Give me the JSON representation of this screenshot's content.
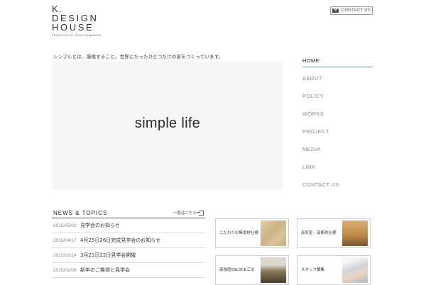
{
  "header": {
    "logo_line1": "K.",
    "logo_line2": "DESIGN",
    "logo_line3": "HOUSE",
    "logo_sub": "PRODUCED BY KENJI KAWAMATA",
    "contact_label": "CONTACT US"
  },
  "tagline": "シンプルとは、凝縮すること。世界にたったひとつだけの家をつくっています。",
  "hero": {
    "text": "simple life"
  },
  "nav": {
    "items": [
      {
        "label": "HOME"
      },
      {
        "label": "ABOUT"
      },
      {
        "label": "POLICY"
      },
      {
        "label": "WORKS"
      },
      {
        "label": "PROJECT"
      },
      {
        "label": "MEDIA"
      },
      {
        "label": "LINK"
      },
      {
        "label": "CONTACT US"
      }
    ],
    "active": "HOME"
  },
  "news": {
    "title": "NEWS & TOPICS",
    "more_label": "一覧はこちら",
    "items": [
      {
        "date": "2015/05/02",
        "text": "見学会のお知らせ"
      },
      {
        "date": "2015/04/17",
        "text": "4月25日26日完成見学会のお知らせ"
      },
      {
        "date": "2015/03/14",
        "text": "3月21日22日見学会開催"
      },
      {
        "date": "2015/01/09",
        "text": "新年のご挨拶と見学会"
      }
    ]
  },
  "cards": [
    {
      "label": "こだわりの無垢材仕様",
      "image": "wood-texture"
    },
    {
      "label": "高気密・高断熱仕様",
      "image": "timber-frame"
    },
    {
      "label": "高強度SSLOCK工法",
      "image": "house-model"
    },
    {
      "label": "スタッフ募集",
      "image": "handshake"
    }
  ],
  "colors": {
    "accent": "#7a9a92",
    "text": "#333333",
    "nav_inactive": "#8a8a8a"
  }
}
